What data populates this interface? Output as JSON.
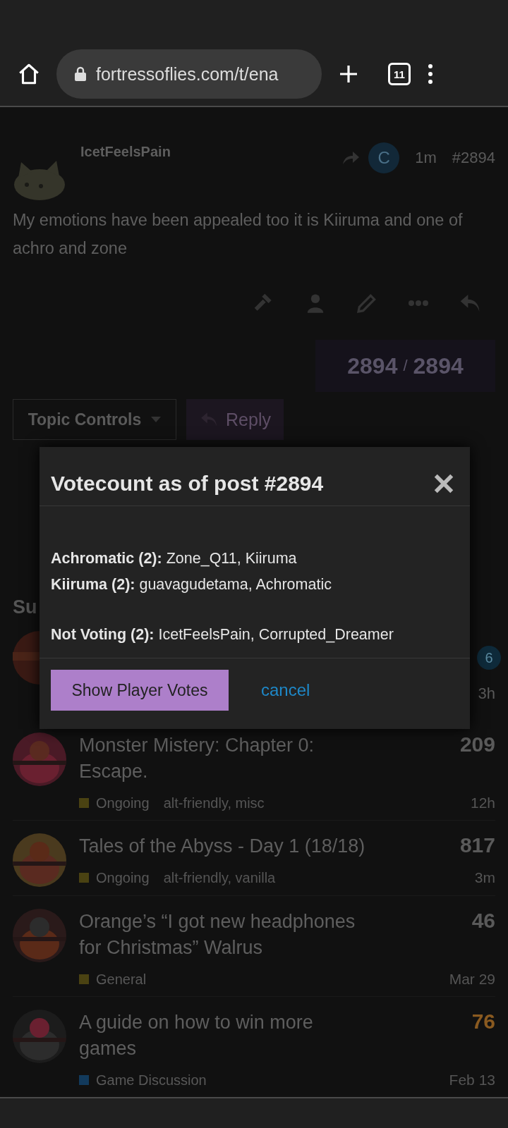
{
  "browser": {
    "url": "fortressoflies.com/t/ena",
    "tab_count": "11"
  },
  "post": {
    "author": "IcetFeelsPain",
    "reply_to_initial": "C",
    "time": "1m",
    "number": "#2894",
    "body": "My emotions have been appealed too it is Kiiruma and one of achro and zone"
  },
  "progress": {
    "current": "2894",
    "separator": "/",
    "total": "2894"
  },
  "topic_controls": {
    "label": "Topic Controls"
  },
  "reply_button": {
    "label": "Reply"
  },
  "suggested_heading": "Su",
  "hidden_topic": {
    "badge": "6",
    "time": "3h"
  },
  "topics": [
    {
      "title": "Monster Mistery: Chapter 0: Escape.",
      "category": "Ongoing",
      "color": "#4a4212",
      "tags": "alt-friendly, misc",
      "count": "209",
      "hot": false,
      "time": "12h"
    },
    {
      "title": "Tales of the Abyss - Day 1 (18/18)",
      "category": "Ongoing",
      "color": "#4a4212",
      "tags": "alt-friendly, vanilla",
      "count": "817",
      "hot": false,
      "time": "3m"
    },
    {
      "title": "Orange’s “I got new headphones for Christmas” Walrus",
      "category": "General",
      "color": "#4a4212",
      "count": "46",
      "hot": false,
      "time": "Mar 29"
    },
    {
      "title": "A guide on how to win more games",
      "category": "Game Discussion",
      "color": "#123a5c",
      "count": "76",
      "hot": true,
      "time": "Feb 13"
    }
  ],
  "modal": {
    "title": "Votecount as of post #2894",
    "groups": [
      [
        {
          "label": "Achromatic (2):",
          "names": "Zone_Q11, Kiiruma"
        },
        {
          "label": "Kiiruma (2):",
          "names": "guavagudetama, Achromatic"
        }
      ],
      [
        {
          "label": "Not Voting (2):",
          "names": "IcetFeelsPain, Corrupted_Dreamer"
        }
      ]
    ],
    "primary_button": "Show Player Votes",
    "cancel_link": "cancel"
  }
}
